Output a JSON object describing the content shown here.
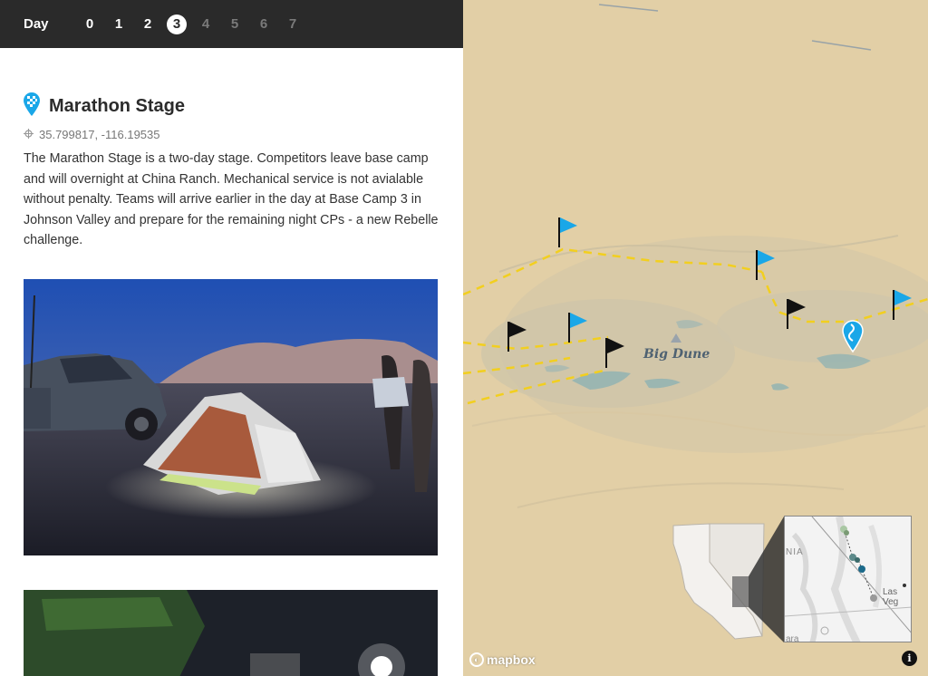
{
  "daybar": {
    "label": "Day",
    "days": [
      "0",
      "1",
      "2",
      "3",
      "4",
      "5",
      "6",
      "7"
    ],
    "active_day": "3"
  },
  "stage": {
    "title": "Marathon Stage",
    "coordinates": "35.799817, -116.19535",
    "description": "The Marathon Stage is a two-day stage. Competitors leave base camp and will overnight at China Ranch. Mechanical service is not avialable without penalty. Teams will arrive earlier in the day at Base Camp 3 in Johnson Valley and prepare for the remaining night CPs - a new Rebelle challenge."
  },
  "map": {
    "place_label": "Big Dune",
    "attribution": "mapbox",
    "info_icon": "info-icon",
    "inset": {
      "label_state": "NIA",
      "label_city": "Las Veg",
      "label_bottom": "ara"
    }
  },
  "icons": {
    "stage_marker": "checkered-pin-icon",
    "coords": "crosshair-icon",
    "flags": "flag-icon",
    "location": "location-pin-icon"
  },
  "colors": {
    "accent_blue": "#1aa7e8",
    "route_yellow": "#f2cf1f",
    "topbar": "#2a2a2a",
    "sand": "#e2cfa6"
  }
}
